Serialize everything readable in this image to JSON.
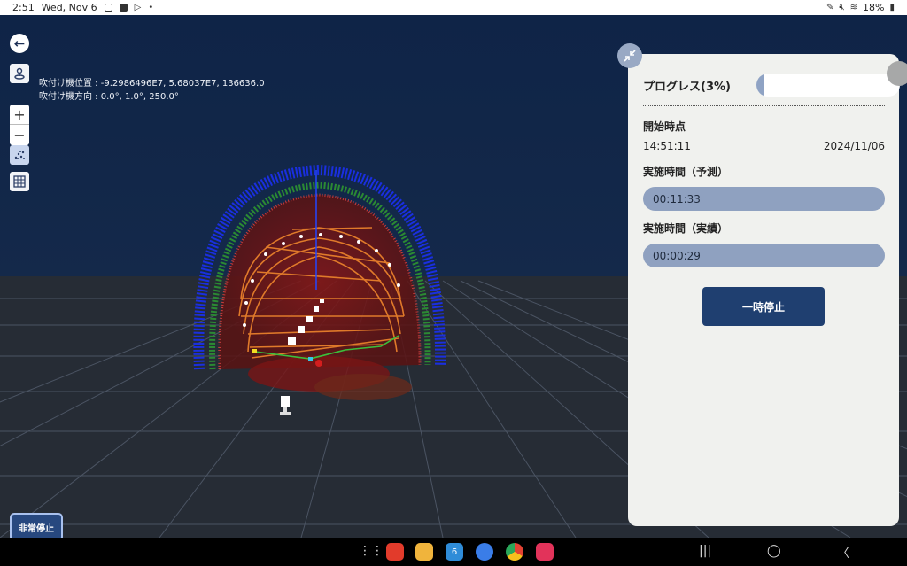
{
  "status_bar": {
    "time": "2:51",
    "date": "Wed, Nov 6",
    "battery": "18%"
  },
  "viewer": {
    "coord_line_1": "吹付け機位置 : -9.2986496E7, 5.68037E7, 136636.0",
    "coord_line_2": "吹付け機方向 : 0.0°, 1.0°, 250.0°",
    "zoom_in_label": "+",
    "zoom_out_label": "−",
    "emergency_stop_label": "非常停止"
  },
  "panel": {
    "progress_label": "プログレス(3%)",
    "progress_fraction": 0.03,
    "start_label": "開始時点",
    "start_time": "14:51:11",
    "start_date": "2024/11/06",
    "estimated_label": "実施時間（予測）",
    "estimated_value": "00:11:33",
    "actual_label": "実施時間（実績）",
    "actual_value": "00:00:29",
    "pause_label": "一時停止"
  },
  "colors": {
    "sky": "#0f2447",
    "panel_bg": "#f0f1ee",
    "pill": "#8fa1c0",
    "pause_button": "#1f3f70",
    "point_cloud_blue": "#1a2fe0",
    "point_cloud_red": "#a01818",
    "path_orange": "#e07a2a"
  },
  "dock": {
    "apps": [
      "app-drawer-icon",
      "flipboard-icon",
      "files-icon",
      "calendar-icon",
      "messages-icon",
      "chrome-icon",
      "screen-recorder-icon"
    ],
    "calendar_day": "6"
  }
}
